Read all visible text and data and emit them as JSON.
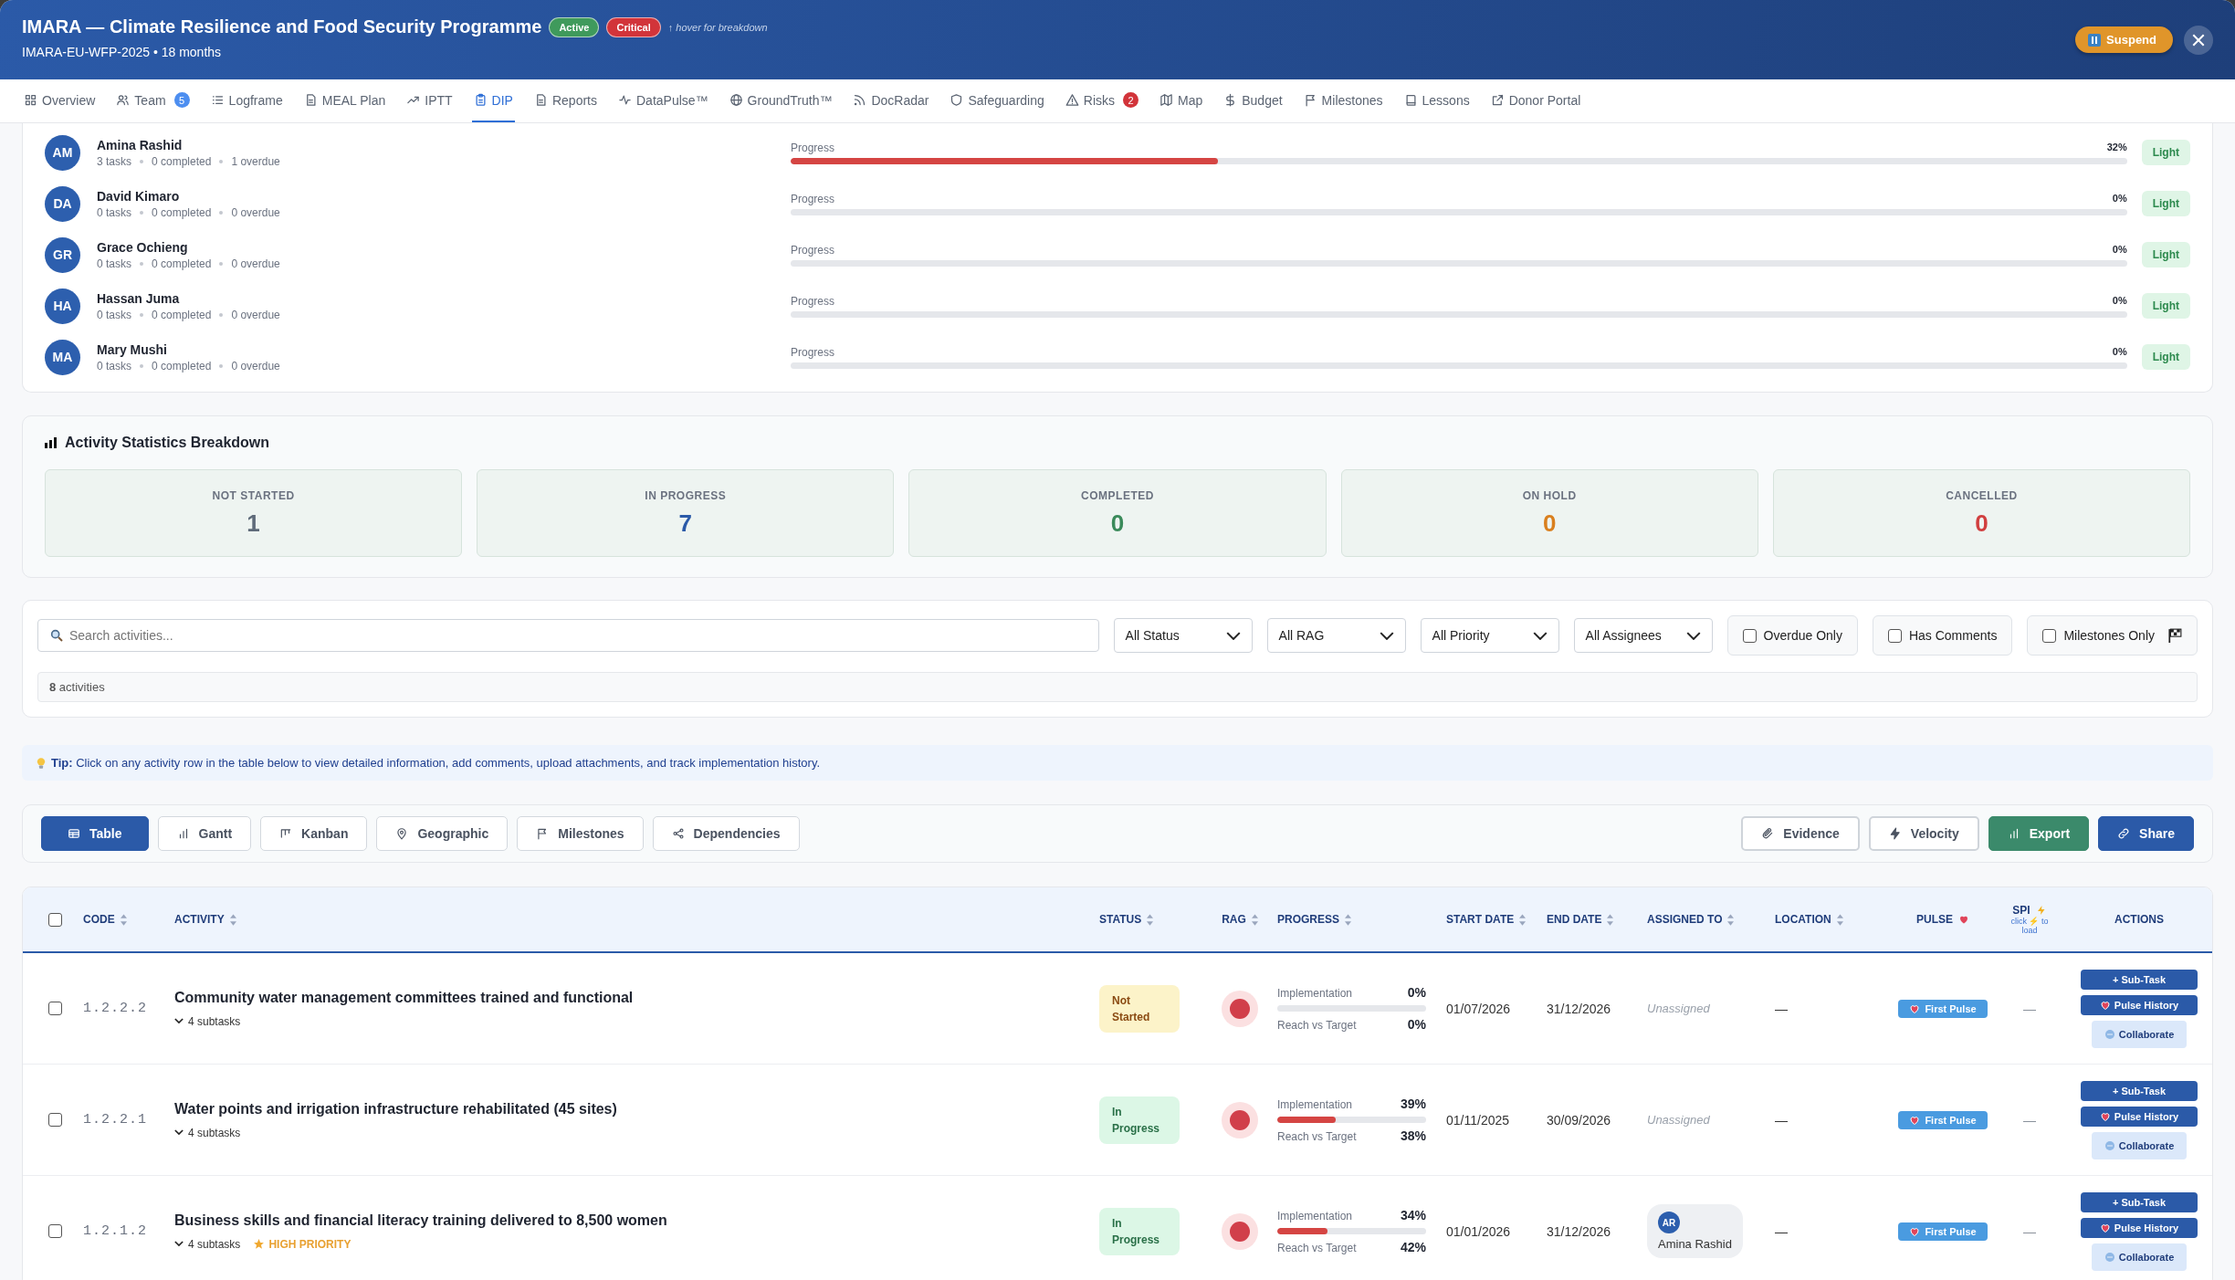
{
  "header": {
    "title": "IMARA — Climate Resilience and Food Security Programme",
    "badges": [
      {
        "label": "Active",
        "kind": "success"
      },
      {
        "label": "Critical",
        "kind": "danger"
      }
    ],
    "hint": "↑ hover for breakdown",
    "subtitle": "IMARA-EU-WFP-2025 • 18 months",
    "suspend": "Suspend"
  },
  "tabs": [
    {
      "label": "Overview",
      "selected": false
    },
    {
      "label": "Team",
      "selected": false,
      "badge": "5",
      "color": "#4d8ef0"
    },
    {
      "label": "Logframe",
      "selected": false
    },
    {
      "label": "MEAL Plan",
      "selected": false
    },
    {
      "label": "IPTT",
      "selected": false
    },
    {
      "label": "DIP",
      "selected": true
    },
    {
      "label": "Reports",
      "selected": false
    },
    {
      "label": "DataPulse™",
      "selected": false
    },
    {
      "label": "GroundTruth™",
      "selected": false
    },
    {
      "label": "DocRadar",
      "selected": false
    },
    {
      "label": "Safeguarding",
      "selected": false
    },
    {
      "label": "Risks",
      "selected": false,
      "badge": "2",
      "color": "#d2343a"
    },
    {
      "label": "Map",
      "selected": false
    },
    {
      "label": "Budget",
      "selected": false
    },
    {
      "label": "Milestones",
      "selected": false
    },
    {
      "label": "Lessons",
      "selected": false
    },
    {
      "label": "Donor Portal",
      "selected": false
    }
  ],
  "team": [
    {
      "initials": "AM",
      "name": "Amina Rashid",
      "tasks": "3 tasks",
      "completed": "0 completed",
      "overdue": "1 overdue",
      "progress_label": "Progress",
      "level": 0.32,
      "percent": "32%",
      "workload": "Light"
    },
    {
      "initials": "DA",
      "name": "David Kimaro",
      "tasks": "0 tasks",
      "completed": "0 completed",
      "overdue": "0 overdue",
      "progress_label": "Progress",
      "level": 0,
      "percent": "0%",
      "workload": "Light"
    },
    {
      "initials": "GR",
      "name": "Grace Ochieng",
      "tasks": "0 tasks",
      "completed": "0 completed",
      "overdue": "0 overdue",
      "progress_label": "Progress",
      "level": 0,
      "percent": "0%",
      "workload": "Light"
    },
    {
      "initials": "HA",
      "name": "Hassan Juma",
      "tasks": "0 tasks",
      "completed": "0 completed",
      "overdue": "0 overdue",
      "progress_label": "Progress",
      "level": 0,
      "percent": "0%",
      "workload": "Light"
    },
    {
      "initials": "MA",
      "name": "Mary Mushi",
      "tasks": "0 tasks",
      "completed": "0 completed",
      "overdue": "0 overdue",
      "progress_label": "Progress",
      "level": 0,
      "percent": "0%",
      "workload": "Light"
    }
  ],
  "stats": {
    "title": "Activity Statistics Breakdown",
    "items": [
      {
        "label": "NOT STARTED",
        "value": "1",
        "color": "#5f6b7a"
      },
      {
        "label": "IN PROGRESS",
        "value": "7",
        "color": "#2b5aa8"
      },
      {
        "label": "COMPLETED",
        "value": "0",
        "color": "#3a8a5a"
      },
      {
        "label": "ON HOLD",
        "value": "0",
        "color": "#d97f1e"
      },
      {
        "label": "CANCELLED",
        "value": "0",
        "color": "#d13f3f"
      }
    ]
  },
  "filters": {
    "search_placeholder": "Search activities...",
    "selects": [
      "All Status",
      "All RAG",
      "All Priority",
      "All Assignees"
    ],
    "toggles": [
      {
        "label": "Overdue Only",
        "checked": false
      },
      {
        "label": "Has Comments",
        "checked": false
      },
      {
        "label": "Milestones Only",
        "checked": false
      }
    ],
    "count": "**8** activities"
  },
  "tip": "**Tip:** Click on any activity row in the table below to view detailed information, add comments, upload attachments, and track implementation history.",
  "views": [
    {
      "label": "Table",
      "selected": true
    },
    {
      "label": "Gantt",
      "selected": false
    },
    {
      "label": "Kanban",
      "selected": false
    },
    {
      "label": "Geographic",
      "selected": false
    },
    {
      "label": "Milestones",
      "selected": false
    },
    {
      "label": "Dependencies",
      "selected": false
    }
  ],
  "actions": [
    {
      "label": "Evidence",
      "kind": "outline"
    },
    {
      "label": "Velocity",
      "kind": "outline"
    },
    {
      "label": "Export",
      "kind": "success"
    },
    {
      "label": "Share",
      "kind": "primary"
    }
  ],
  "table": {
    "all_checked": false,
    "columns": [
      {
        "label": "CODE",
        "sort": true
      },
      {
        "label": "ACTIVITY",
        "sort": true
      },
      {
        "label": "STATUS",
        "sort": true
      },
      {
        "label": "RAG",
        "sort": true
      },
      {
        "label": "PROGRESS",
        "sort": true
      },
      {
        "label": "START DATE",
        "sort": true
      },
      {
        "label": "END DATE",
        "sort": true
      },
      {
        "label": "ASSIGNED TO",
        "sort": true
      },
      {
        "label": "LOCATION",
        "sort": true
      },
      {
        "label": "PULSE",
        "sort": false
      },
      {
        "label": "SPI",
        "sort": false,
        "note": "click ⚡ to load"
      },
      {
        "label": "ACTIONS",
        "sort": false
      }
    ],
    "rows": [
      {
        "checked": false,
        "code": "1.2.2.2",
        "title": "Community water management committees trained and functional",
        "subtasks": "4 subtasks",
        "status": {
          "label": "Not Started",
          "kind": "not_started"
        },
        "color": "#d13f4a",
        "impl_label": "Implementation",
        "impl_pct": "0%",
        "level": 0,
        "reach_label": "Reach vs Target",
        "reach_pct": "0%",
        "start": "01/07/2026",
        "end": "31/12/2026",
        "assignee": {
          "kind": "none",
          "label": "Unassigned"
        },
        "location": "—",
        "pulse": "First Pulse",
        "spi": "—",
        "buttons": [
          "+ Sub-Task",
          "Pulse History",
          "Collaborate"
        ]
      },
      {
        "checked": false,
        "code": "1.2.2.1",
        "title": "Water points and irrigation infrastructure rehabilitated (45 sites)",
        "subtasks": "4 subtasks",
        "status": {
          "label": "In Progress",
          "kind": "in_progress"
        },
        "color": "#d13f4a",
        "impl_label": "Implementation",
        "impl_pct": "39%",
        "level": 0.39,
        "reach_label": "Reach vs Target",
        "reach_pct": "38%",
        "start": "01/11/2025",
        "end": "30/09/2026",
        "assignee": {
          "kind": "none",
          "label": "Unassigned"
        },
        "location": "—",
        "pulse": "First Pulse",
        "spi": "—",
        "buttons": [
          "+ Sub-Task",
          "Pulse History",
          "Collaborate"
        ]
      },
      {
        "checked": false,
        "code": "1.2.1.2",
        "title": "Business skills and financial literacy training delivered to 8,500 women",
        "subtasks": "4 subtasks",
        "priority": "HIGH PRIORITY",
        "status": {
          "label": "In Progress",
          "kind": "in_progress"
        },
        "color": "#d13f4a",
        "impl_label": "Implementation",
        "impl_pct": "34%",
        "level": 0.34,
        "reach_label": "Reach vs Target",
        "reach_pct": "42%",
        "start": "01/01/2026",
        "end": "31/12/2026",
        "assignee": {
          "kind": "person",
          "initials": "AR",
          "name": "Amina Rashid"
        },
        "location": "—",
        "pulse": "First Pulse",
        "spi": "—",
        "buttons": [
          "+ Sub-Task",
          "Pulse History",
          "Collaborate"
        ]
      }
    ]
  }
}
